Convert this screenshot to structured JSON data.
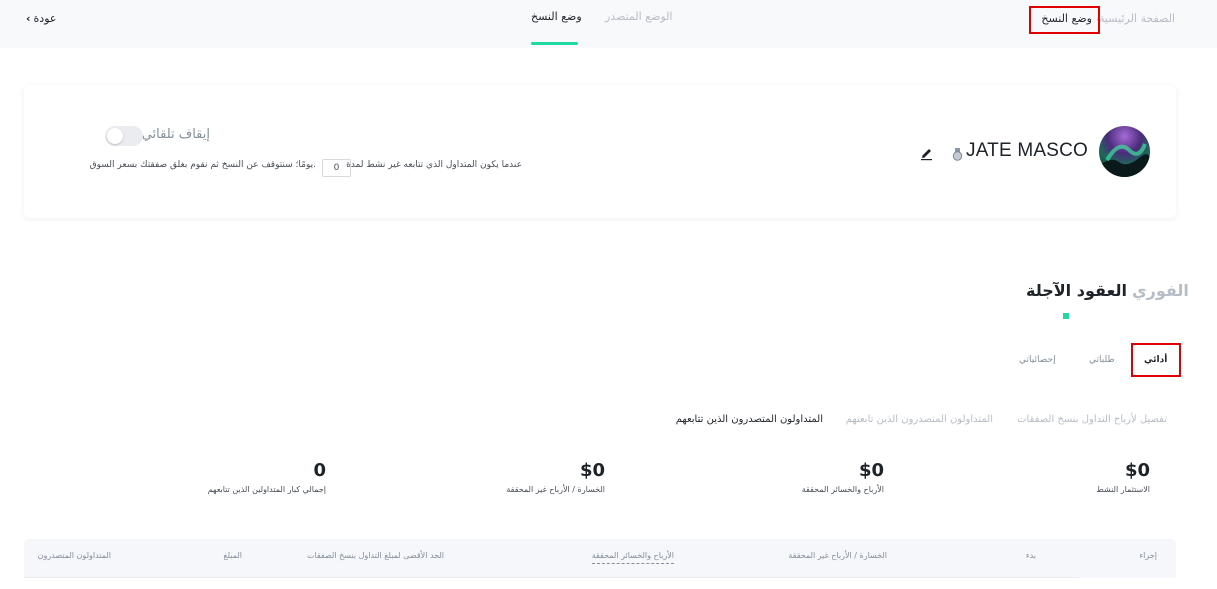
{
  "header": {
    "back_label": "عودة",
    "breadcrumb": {
      "home": "الصفحة الرئيسية",
      "separator": "/",
      "current": "وضع النسخ"
    },
    "mode_tabs": [
      {
        "label": "وضع النسخ",
        "active": true
      },
      {
        "label": "الوضع المتصدر",
        "active": false
      }
    ]
  },
  "profile": {
    "name": "JATE MASCO",
    "auto_stop_label": "إيقاف تلقائي",
    "auto_stop_enabled": false,
    "desc_before": "عندما يكون المتداول الذي تتابعه غير نشط لمدة",
    "days_value": "0",
    "desc_after": "يومًا؛ سنتوقف عن النسخ ثم نقوم بغلق صفقتك بسعر السوق."
  },
  "market_tabs": [
    {
      "label": "الفوري",
      "active": false
    },
    {
      "label": "العقود الآجلة",
      "active": true
    }
  ],
  "sub_tabs": [
    {
      "label": "أدائي",
      "active": true
    },
    {
      "label": "طلباتي",
      "active": false
    },
    {
      "label": "إحصائياتي",
      "active": false
    }
  ],
  "list_tabs": [
    {
      "label": "تفصيل لأرباح التداول بنسخ الصفقات",
      "active": false
    },
    {
      "label": "المتداولون المتصدرون الذين تابعتهم",
      "active": false
    },
    {
      "label": "المتداولون المتصدرون الذين تتابعهم",
      "active": true
    }
  ],
  "stats": [
    {
      "value": "$0",
      "label": "الاستثمار النشط"
    },
    {
      "value": "$0",
      "label": "الأرباح والخسائر المحققة"
    },
    {
      "value": "$0",
      "label": "الخسارة / الأرباح غير المحققة"
    },
    {
      "value": "0",
      "label": "إجمالي كبار المتداولين الذين تتابعهم"
    }
  ],
  "table": {
    "columns": [
      "إجراء",
      "بدء",
      "الخسارة / الأرباح غير المحققة",
      "الأرباح والخسائر المحققة",
      "الحد الأقصى لمبلغ التداول بنسخ الصفقات",
      "المبلغ",
      "المتداولون المتصدرون"
    ]
  },
  "colors": {
    "accent": "#1ed9a0",
    "highlight_box": "#e00000",
    "muted_text": "#b7bdc6"
  },
  "icons": [
    "chevron-left-icon",
    "medal-icon",
    "edit-icon"
  ]
}
